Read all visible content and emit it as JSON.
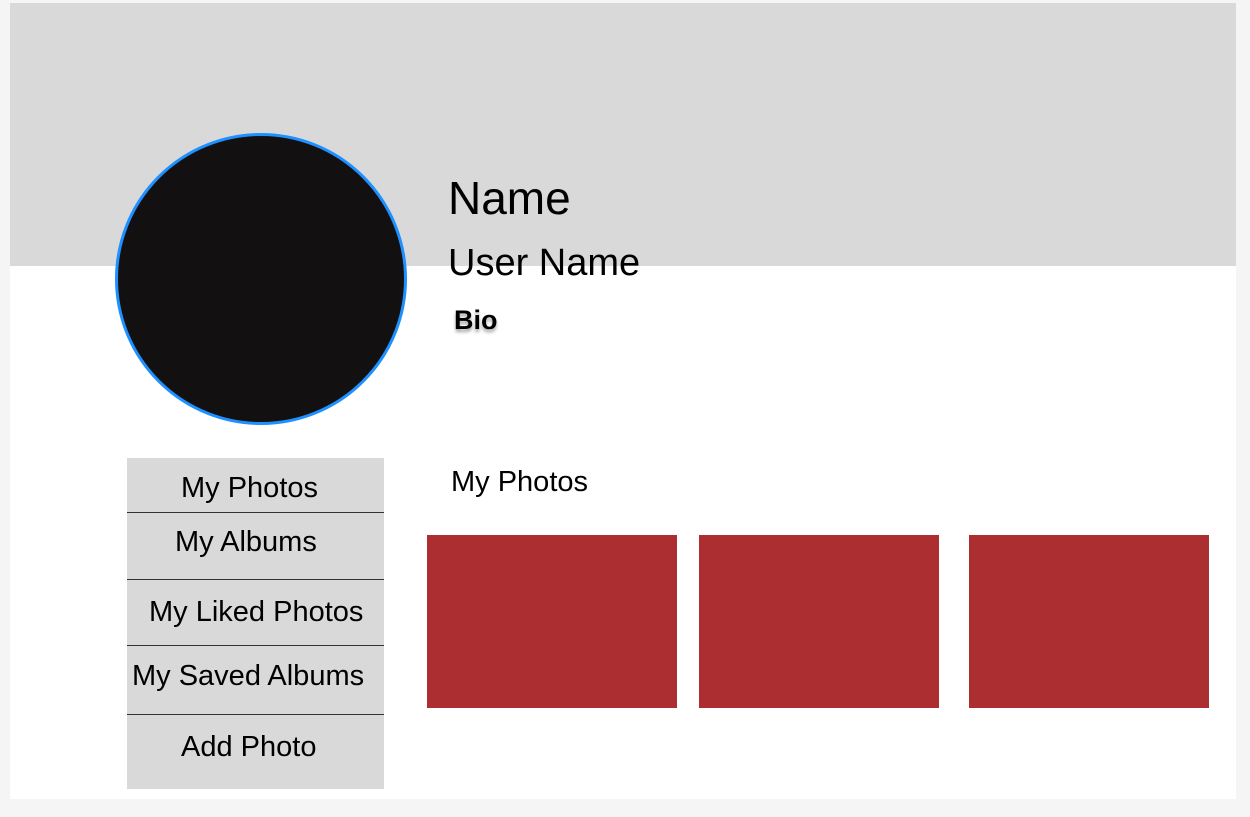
{
  "profile": {
    "name": "Name",
    "username": "User Name",
    "bio": "Bio"
  },
  "sidebar": {
    "items": [
      {
        "label": "My Photos"
      },
      {
        "label": "My Albums"
      },
      {
        "label": "My Liked Photos"
      },
      {
        "label": "My Saved Albums"
      },
      {
        "label": "Add Photo"
      }
    ]
  },
  "main": {
    "section_title": "My Photos",
    "photo_count": 3
  },
  "colors": {
    "cover": "#d9d9d9",
    "avatar_fill": "#121010",
    "avatar_border": "#1e90ff",
    "sidebar_bg": "#d9d9d9",
    "photo_tile": "#ac2e30"
  }
}
